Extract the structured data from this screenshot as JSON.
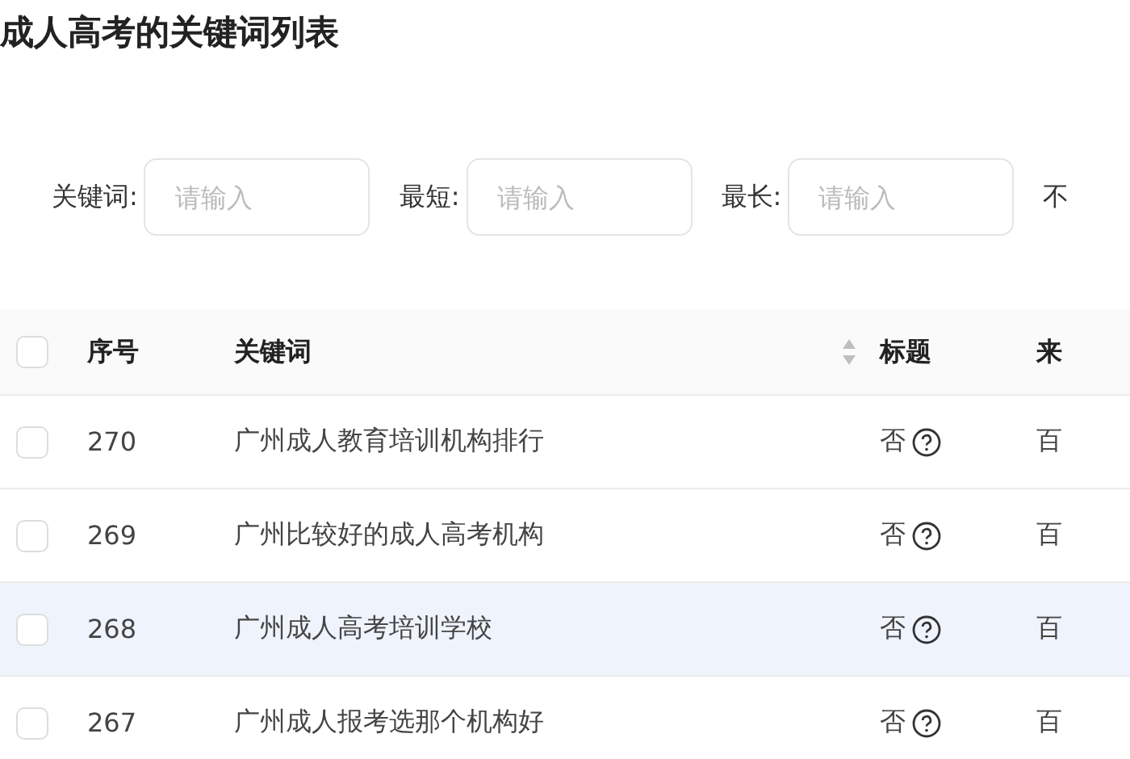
{
  "title": "成人高考的关键词列表",
  "filters": [
    {
      "label": "关键词:",
      "placeholder": "请输入"
    },
    {
      "label": "最短:",
      "placeholder": "请输入"
    },
    {
      "label": "最长:",
      "placeholder": "请输入"
    }
  ],
  "filter_tail": "不",
  "table": {
    "select_all": {
      "checked": false
    },
    "columns": [
      "序号",
      "关键词",
      "标题",
      "来"
    ],
    "rows": [
      {
        "checked": false,
        "selected": false,
        "index": "270",
        "keyword": "广州成人教育培训机构排行",
        "title_flag": "否",
        "source": "百"
      },
      {
        "checked": false,
        "selected": false,
        "index": "269",
        "keyword": "广州比较好的成人高考机构",
        "title_flag": "否",
        "source": "百"
      },
      {
        "checked": false,
        "selected": true,
        "index": "268",
        "keyword": "广州成人高考培训学校",
        "title_flag": "否",
        "source": "百"
      },
      {
        "checked": false,
        "selected": false,
        "index": "267",
        "keyword": "广州成人报考选那个机构好",
        "title_flag": "否",
        "source": "百"
      }
    ]
  }
}
